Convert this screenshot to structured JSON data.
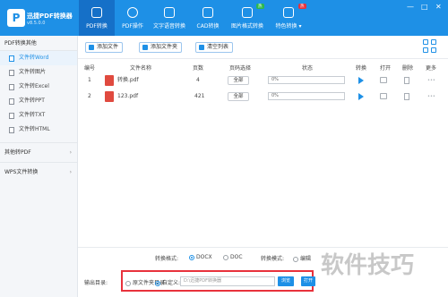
{
  "app": {
    "logo_letter": "P",
    "name": "迅捷PDF转换器",
    "version": "v8.5.0.0"
  },
  "nav": [
    {
      "label": "PDF转换",
      "icon": "convert-icon",
      "active": true
    },
    {
      "label": "PDF操作",
      "icon": "pdf-tools-icon",
      "active": false
    },
    {
      "label": "文字语音转换",
      "icon": "text-speech-icon",
      "active": false
    },
    {
      "label": "CAD转换",
      "icon": "cad-icon",
      "active": false
    },
    {
      "label": "图片格式转换",
      "icon": "image-icon",
      "active": false
    },
    {
      "label": "特色转换 ▾",
      "icon": "feature-icon",
      "active": false
    }
  ],
  "badges": {
    "nav4": "热",
    "nav5": "热"
  },
  "window_controls": {
    "minimize": "—",
    "maximize": "□",
    "close": "✕"
  },
  "sidebar": {
    "header": "PDF转换其他",
    "items": [
      "文件转Word",
      "文件转图片",
      "文件转Excel",
      "文件转PPT",
      "文件转TXT",
      "文件转HTML"
    ],
    "groups": [
      "其他转PDF",
      "WPS文件转换"
    ],
    "chevron": "›"
  },
  "toolbar": {
    "add_file": "添加文件",
    "add_folder": "添加文件夹",
    "clear_list": "清空列表"
  },
  "table": {
    "headers": {
      "index": "编号",
      "name": "文件名称",
      "pages": "页数",
      "page_select": "页码选择",
      "status": "状态",
      "convert": "转换",
      "open": "打开",
      "delete": "删除",
      "more": "更多"
    },
    "rows": [
      {
        "index": "1",
        "name": "转换.pdf",
        "pages": "4",
        "page_select": "全部",
        "progress": "0%"
      },
      {
        "index": "2",
        "name": "123.pdf",
        "pages": "421",
        "page_select": "全部",
        "progress": "0%"
      }
    ]
  },
  "bottom": {
    "format_label": "转换格式:",
    "format_docx": "DOCX",
    "format_doc": "DOC",
    "mode_label": "转换模式:",
    "mode_option": "编辑",
    "output_label": "输出目录:",
    "original_dir": "原文件夹目录",
    "custom": "自定义:",
    "path_placeholder": "D:\\迅捷PDF转换器",
    "browse": "浏览",
    "open": "打开"
  },
  "watermark": "软件技巧",
  "colors": {
    "accent": "#1e90e6",
    "pdf_red": "#e04a3f",
    "highlight_box": "#e8323c"
  }
}
